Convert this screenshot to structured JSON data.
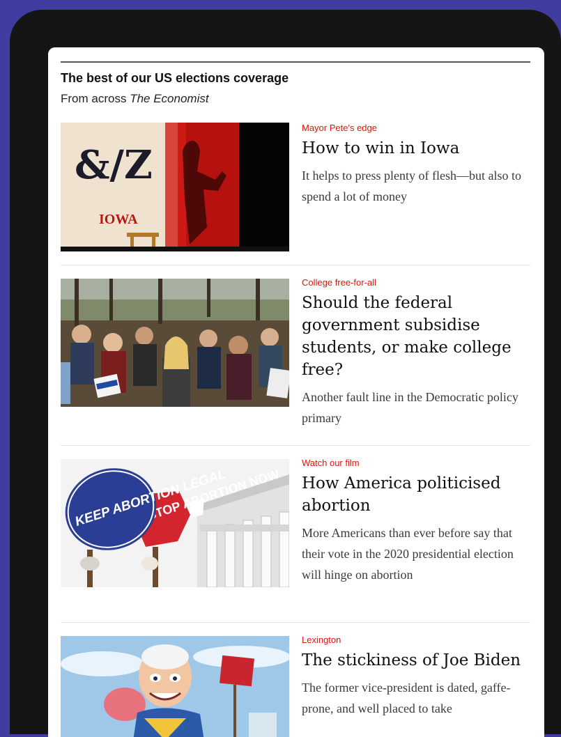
{
  "section": {
    "title": "The best of our US elections coverage",
    "subtitle_prefix": "From across ",
    "subtitle_brand": "The Economist"
  },
  "articles": [
    {
      "kicker": "Mayor Pete's edge",
      "headline": "How to win in Iowa",
      "description": "It helps to press plenty of flesh—but also to spend a lot of money",
      "image_label": "IOWA",
      "image_sign": "&/Z"
    },
    {
      "kicker": "College free-for-all",
      "headline": "Should the federal government subsidise students, or make college free?",
      "description": "Another fault line in the Democratic policy primary"
    },
    {
      "kicker": "Watch our film",
      "headline": "How America politicised abortion",
      "description": "More Americans than ever before say that their vote in the 2020 presidential election will hinge on abortion",
      "image_sign_text": "KEEP ABORTION LEGAL",
      "image_sign_text_2": "STOP ABORTION NOW"
    },
    {
      "kicker": "Lexington",
      "headline": "The stickiness of Joe Biden",
      "description": "The former vice-president is dated, gaffe-prone, and well placed to take"
    }
  ],
  "colors": {
    "background": "#3f3ea0",
    "device": "#151515",
    "kicker": "#e3120b"
  }
}
